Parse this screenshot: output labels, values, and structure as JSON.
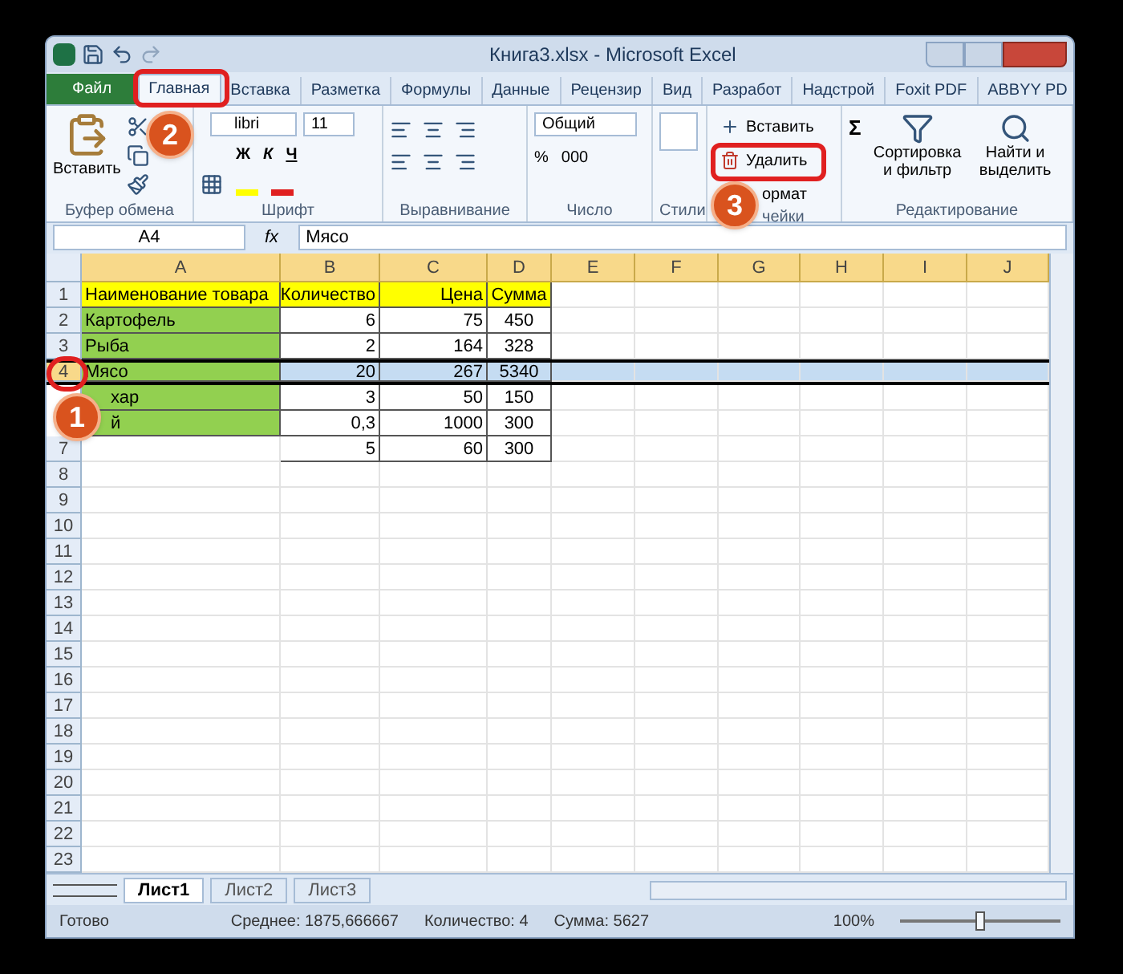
{
  "window": {
    "title": "Книга3.xlsx - Microsoft Excel"
  },
  "tabs": [
    {
      "label": "Файл",
      "kind": "file",
      "selected": false
    },
    {
      "label": "Главная",
      "kind": "tab",
      "selected": true
    },
    {
      "label": "Вставка",
      "kind": "tab",
      "selected": false
    },
    {
      "label": "Разметка",
      "kind": "tab",
      "selected": false
    },
    {
      "label": "Формулы",
      "kind": "tab",
      "selected": false
    },
    {
      "label": "Данные",
      "kind": "tab",
      "selected": false
    },
    {
      "label": "Рецензир",
      "kind": "tab",
      "selected": false
    },
    {
      "label": "Вид",
      "kind": "tab",
      "selected": false
    },
    {
      "label": "Разработ",
      "kind": "tab",
      "selected": false
    },
    {
      "label": "Надстрой",
      "kind": "tab",
      "selected": false
    },
    {
      "label": "Foxit PDF",
      "kind": "tab",
      "selected": false
    },
    {
      "label": "ABBYY PD",
      "kind": "tab",
      "selected": false
    }
  ],
  "ribbon": {
    "clipboard": {
      "paste": "Вставить",
      "label": "Буфер обмена"
    },
    "font": {
      "name": "libri",
      "size": "11",
      "styles": [
        "Ж",
        "К",
        "Ч"
      ],
      "label": "Шрифт"
    },
    "alignment": {
      "label": "Выравнивание"
    },
    "number": {
      "format": "Общий",
      "percent": "%",
      "thousands": "000",
      "label": "Число"
    },
    "styles": {
      "label": "Стили"
    },
    "cells": {
      "insert": "Вставить",
      "delete": "Удалить",
      "format": "ормат",
      "label": "чейки"
    },
    "editing": {
      "sum": "Σ",
      "sort": "Сортировка и фильтр",
      "find": "Найти и выделить",
      "label": "Редактирование"
    }
  },
  "formula_bar": {
    "name_box": "A4",
    "fx": "fx",
    "value": "Мясо"
  },
  "columns": [
    "A",
    "B",
    "C",
    "D",
    "E",
    "F",
    "G",
    "H",
    "I",
    "J"
  ],
  "rows": [
    {
      "number": "1",
      "selected": false,
      "cells": [
        {
          "text": "Наименование товара",
          "color": "#ffff00"
        },
        {
          "text": "Количество",
          "color": "#ffff00"
        },
        {
          "text": "Цена",
          "color": "#ffff00"
        },
        {
          "text": "Сумма",
          "color": "#ffff00"
        }
      ]
    },
    {
      "number": "2",
      "selected": false,
      "cells": [
        {
          "text": "Картофель",
          "color": "#92d050"
        },
        {
          "text": "6"
        },
        {
          "text": "75"
        },
        {
          "text": "450"
        }
      ]
    },
    {
      "number": "3",
      "selected": false,
      "cells": [
        {
          "text": "Рыба",
          "color": "#92d050"
        },
        {
          "text": "2"
        },
        {
          "text": "164"
        },
        {
          "text": "328"
        }
      ]
    },
    {
      "number": "4",
      "selected": true,
      "cells": [
        {
          "text": "Мясо",
          "color": "#92d050"
        },
        {
          "text": "20"
        },
        {
          "text": "267"
        },
        {
          "text": "5340"
        }
      ]
    },
    {
      "selected": false,
      "cells": [
        {
          "text": "хар",
          "color": "#92d050"
        },
        {
          "text": "3"
        },
        {
          "text": "50"
        },
        {
          "text": "150"
        }
      ]
    },
    {
      "selected": false,
      "cells": [
        {
          "text": "й",
          "color": "#92d050"
        },
        {
          "text": "0,3"
        },
        {
          "text": "1000"
        },
        {
          "text": "300"
        }
      ]
    },
    {
      "number": "7",
      "selected": false,
      "cells": [
        {
          "kind": "empty"
        },
        {
          "text": "5"
        },
        {
          "text": "60"
        },
        {
          "text": "300"
        }
      ]
    },
    {
      "number": "8",
      "selected": false
    },
    {
      "number": "9",
      "selected": false
    },
    {
      "number": "10",
      "selected": false
    },
    {
      "number": "11",
      "selected": false
    },
    {
      "number": "12",
      "selected": false
    },
    {
      "number": "13",
      "selected": false
    },
    {
      "number": "14",
      "selected": false
    },
    {
      "number": "15",
      "selected": false
    },
    {
      "number": "16",
      "selected": false
    },
    {
      "number": "17",
      "selected": false
    },
    {
      "number": "18",
      "selected": false
    },
    {
      "number": "19",
      "selected": false
    },
    {
      "number": "20",
      "selected": false
    },
    {
      "number": "21",
      "selected": false
    },
    {
      "number": "22",
      "selected": false
    },
    {
      "number": "23",
      "selected": false
    }
  ],
  "sheets": [
    {
      "label": "Лист1",
      "selected": true
    },
    {
      "label": "Лист2",
      "selected": false
    },
    {
      "label": "Лист3",
      "selected": false
    }
  ],
  "status_bar": {
    "ready": "Готово",
    "average": "Среднее: 1875,666667",
    "count": "Количество: 4",
    "sum": "Сумма: 5627",
    "zoom": "100%",
    "zoom_slider": {
      "level": 0.5
    }
  },
  "callouts": [
    {
      "number": "1",
      "kind": "row"
    },
    {
      "number": "2",
      "kind": "tab"
    },
    {
      "number": "3",
      "kind": "delete"
    }
  ]
}
